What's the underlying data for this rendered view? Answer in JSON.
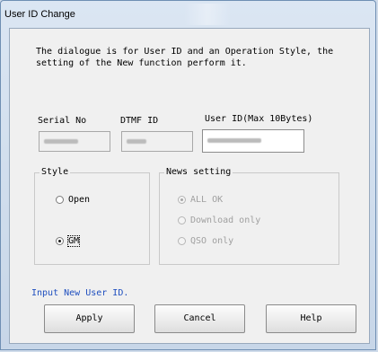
{
  "window": {
    "title": "User ID Change"
  },
  "description": "The dialogue is for User ID and an Operation Style, the\nsetting of the New function perform it.",
  "fields": {
    "serial_no": {
      "label": "Serial No",
      "value": "(blurred)"
    },
    "dtmf_id": {
      "label": "DTMF ID",
      "value": "(blurred)"
    },
    "user_id": {
      "label": "User ID(Max 10Bytes)",
      "value": "(blurred)"
    }
  },
  "style_group": {
    "title": "Style",
    "options": [
      {
        "label": "Open",
        "checked": false
      },
      {
        "label": "GM",
        "checked": true
      }
    ]
  },
  "news_group": {
    "title": "News setting",
    "options": [
      {
        "label": "ALL OK",
        "checked": true,
        "disabled": true
      },
      {
        "label": "Download only",
        "checked": false,
        "disabled": true
      },
      {
        "label": "QSO only",
        "checked": false,
        "disabled": true
      }
    ]
  },
  "status_text": "Input New User ID.",
  "buttons": {
    "apply": "Apply",
    "cancel": "Cancel",
    "help": "Help"
  },
  "colors": {
    "status_text": "#1f4fbf",
    "title_bar": "#c7d6e8"
  }
}
